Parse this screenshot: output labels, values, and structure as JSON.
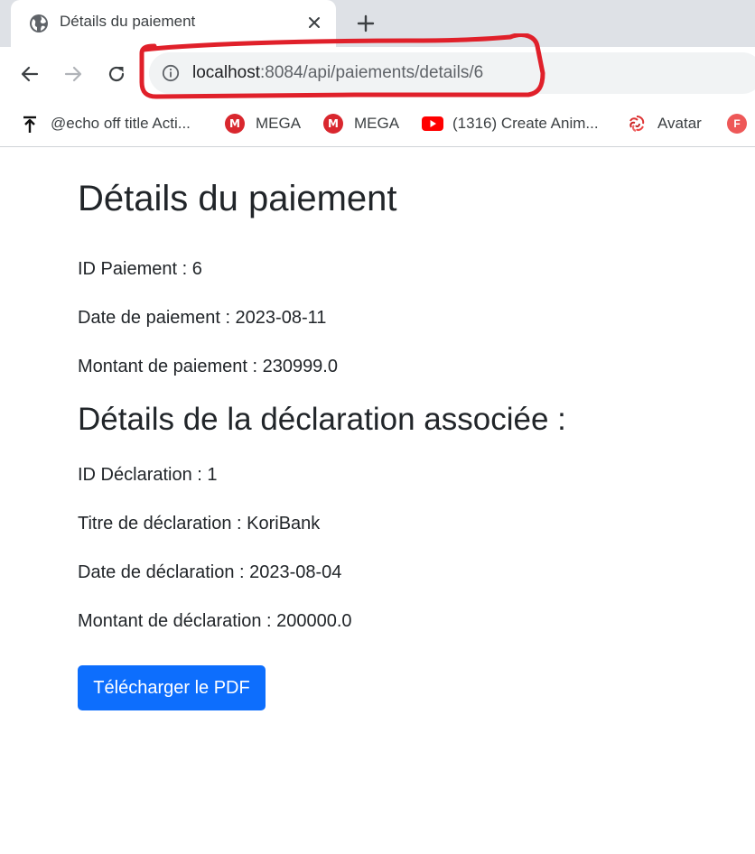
{
  "browser": {
    "tab": {
      "title": "Détails du paiement",
      "icon": "globe-icon"
    },
    "url": {
      "host": "localhost",
      "rest": ":8084/api/paiements/details/6"
    },
    "bookmarks": [
      {
        "label": "@echo off title Acti...",
        "icon": "arrow-up-bar-icon"
      },
      {
        "label": "MEGA",
        "icon": "mega-icon",
        "badge": "M"
      },
      {
        "label": "MEGA",
        "icon": "mega-icon",
        "badge": "M"
      },
      {
        "label": "(1316) Create Anim...",
        "icon": "youtube-icon"
      },
      {
        "label": "Avatar",
        "icon": "avatar-swirl-icon"
      },
      {
        "label": "",
        "icon": "f-icon",
        "badge": "F"
      }
    ],
    "highlight_color": "#e0202a"
  },
  "page": {
    "title": "Détails du paiement",
    "payment": {
      "id": "ID Paiement : 6",
      "date": "Date de paiement : 2023-08-11",
      "amount": "Montant de paiement : 230999.0"
    },
    "declaration_title": "Détails de la déclaration associée :",
    "declaration": {
      "id": "ID Déclaration : 1",
      "title": "Titre de déclaration : KoriBank",
      "date": "Date de déclaration : 2023-08-04",
      "amount": "Montant de déclaration : 200000.0"
    },
    "download_button": "Télécharger le PDF",
    "button_color": "#0d6efd"
  }
}
